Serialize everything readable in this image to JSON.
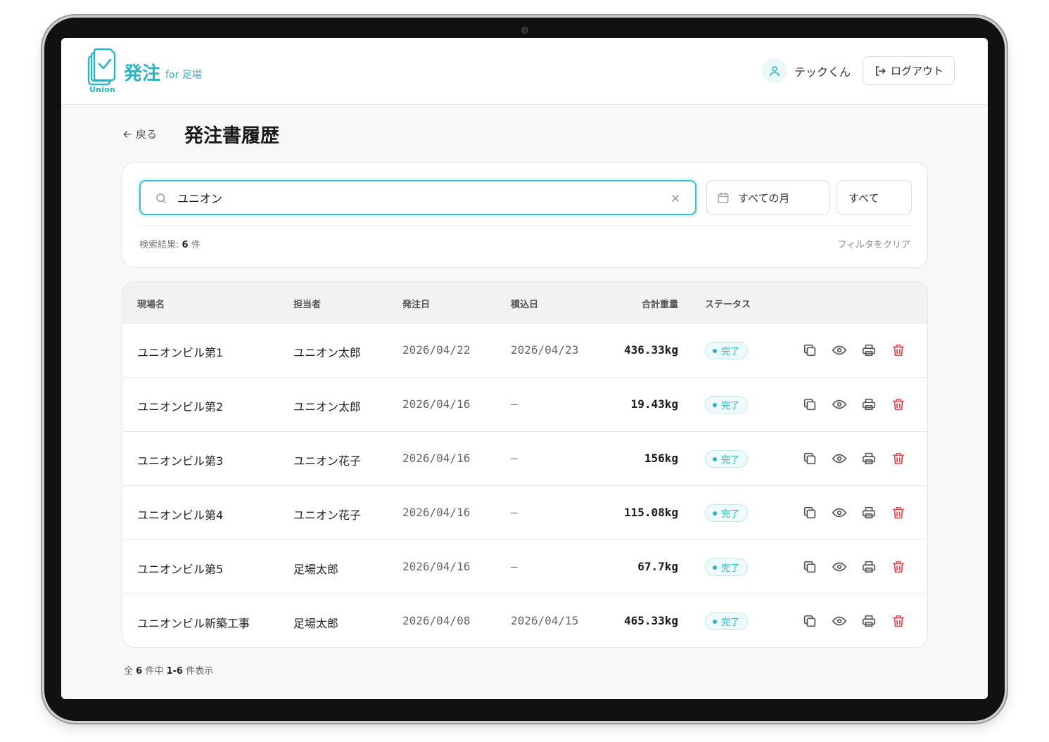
{
  "header": {
    "logo_title": "発注",
    "logo_subtitle": "for 足場",
    "logo_wordmark": "Union",
    "user_name": "テックくん",
    "logout_label": "ログアウト"
  },
  "page": {
    "back_label": "戻る",
    "title": "発注書履歴"
  },
  "filters": {
    "search_value": "ユニオン",
    "month_filter": "すべての月",
    "status_filter": "すべて",
    "result_label": "検索結果: ",
    "result_count": "6",
    "result_unit": " 件",
    "clear_label": "フィルタをクリア"
  },
  "table": {
    "columns": [
      "現場名",
      "担当者",
      "発注日",
      "積込日",
      "合計重量",
      "ステータス"
    ],
    "rows": [
      {
        "site": "ユニオンビル第1",
        "person": "ユニオン太郎",
        "order_date": "2026/04/22",
        "load_date": "2026/04/23",
        "weight": "436.33kg",
        "status": "完了"
      },
      {
        "site": "ユニオンビル第2",
        "person": "ユニオン太郎",
        "order_date": "2026/04/16",
        "load_date": "–",
        "weight": "19.43kg",
        "status": "完了"
      },
      {
        "site": "ユニオンビル第3",
        "person": "ユニオン花子",
        "order_date": "2026/04/16",
        "load_date": "–",
        "weight": "156kg",
        "status": "完了"
      },
      {
        "site": "ユニオンビル第4",
        "person": "ユニオン花子",
        "order_date": "2026/04/16",
        "load_date": "–",
        "weight": "115.08kg",
        "status": "完了"
      },
      {
        "site": "ユニオンビル第5",
        "person": "足場太郎",
        "order_date": "2026/04/16",
        "load_date": "–",
        "weight": "67.7kg",
        "status": "完了"
      },
      {
        "site": "ユニオンビル新築工事",
        "person": "足場太郎",
        "order_date": "2026/04/08",
        "load_date": "2026/04/15",
        "weight": "465.33kg",
        "status": "完了"
      }
    ]
  },
  "pagination": {
    "prefix": "全 ",
    "total": "6",
    "middle": " 件中 ",
    "range": "1-6",
    "suffix": " 件表示"
  },
  "colors": {
    "accent": "#2bb3c0",
    "delete": "#e5484d"
  },
  "icons": [
    "user-icon",
    "logout-icon",
    "arrow-left-icon",
    "search-icon",
    "close-icon",
    "calendar-icon",
    "copy-icon",
    "eye-icon",
    "printer-icon",
    "trash-icon"
  ]
}
